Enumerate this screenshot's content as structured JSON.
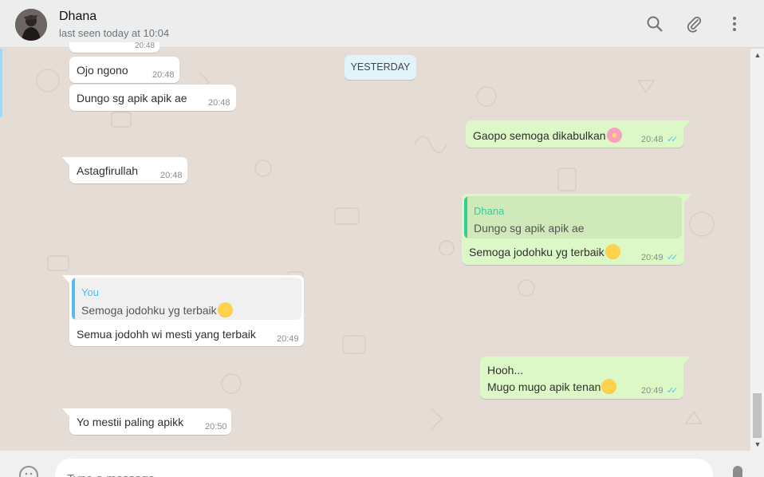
{
  "header": {
    "contact_name": "Dhana",
    "last_seen": "last seen today at 10:04",
    "icons": [
      "search-icon",
      "attach-icon",
      "menu-icon"
    ]
  },
  "date_separator": "YESTERDAY",
  "messages": [
    {
      "direction": "in",
      "text": "Ojo ngono",
      "time": "20:48"
    },
    {
      "direction": "in",
      "text": "Dungo sg apik apik ae",
      "time": "20:48"
    },
    {
      "direction": "out",
      "text": "Gaopo semoga dikabulkan",
      "emoji": "flower",
      "time": "20:48",
      "status": "read"
    },
    {
      "direction": "in",
      "text": "Astagfirullah",
      "time": "20:48"
    },
    {
      "direction": "out",
      "quote_author": "Dhana",
      "quote_text": "Dungo sg apik apik ae",
      "text": "Semoga jodohku yg terbaik",
      "emoji": "smiling-face-with-hearts",
      "time": "20:49",
      "status": "read"
    },
    {
      "direction": "in",
      "quote_author": "You",
      "quote_text": "Semoga jodohku yg terbaik",
      "text": "Semua jodohh wi mesti yang terbaik",
      "time": "20:49"
    },
    {
      "direction": "out",
      "line1": "Hooh...",
      "line2": "Mugo mugo apik tenan",
      "emoji": "pleading-face",
      "time": "20:49",
      "status": "read"
    },
    {
      "direction": "in",
      "text": "Yo mestii paling apikk",
      "time": "20:50"
    }
  ],
  "partial_time_top": "20:48",
  "composer": {
    "placeholder": "Type a message"
  },
  "colors": {
    "incoming": "#ffffff",
    "outgoing": "#dcf8c6",
    "quote_dhana": "#35cd96",
    "quote_you": "#53bdeb",
    "read_tick": "#4fc3f7",
    "chat_bg": "#e5ddd5"
  }
}
